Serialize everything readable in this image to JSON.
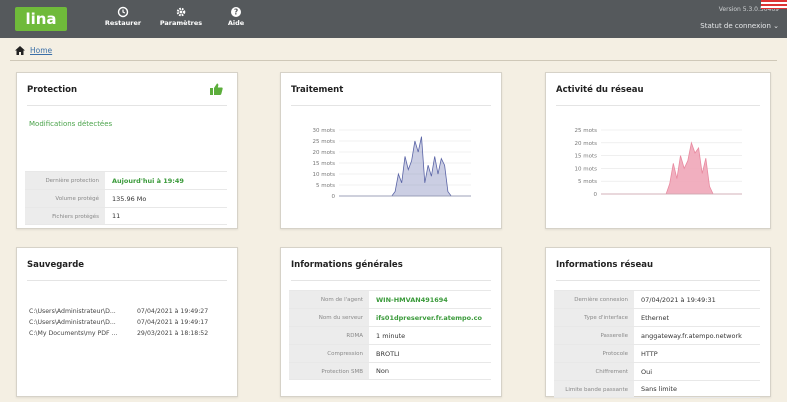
{
  "app": {
    "logo": "lina",
    "version": "Version 5.3.0.50469",
    "status_menu": "Statut de connexion"
  },
  "nav": [
    {
      "label": "Restaurer",
      "icon": "restore-icon"
    },
    {
      "label": "Paramètres",
      "icon": "gear-icon"
    },
    {
      "label": "Aide",
      "icon": "help-icon"
    }
  ],
  "breadcrumb": {
    "home": "Home"
  },
  "protection": {
    "title": "Protection",
    "message": "Modifications détectées",
    "rows": [
      {
        "key": "Dernière protection",
        "value": "Aujourd'hui à 19:49"
      },
      {
        "key": "Volume protégé",
        "value": "135.96 Mo"
      },
      {
        "key": "Fichiers protégés",
        "value": "11"
      }
    ]
  },
  "traitement": {
    "title": "Traitement",
    "color": "#6a74b0",
    "chart_data": {
      "type": "area",
      "title": "Traitement",
      "y_ticks": [
        "30 mots",
        "25 mots",
        "20 mots",
        "15 mots",
        "10 mots",
        "5 mots",
        "0"
      ],
      "ylim": [
        0,
        30
      ],
      "values": [
        0,
        0,
        0,
        0,
        0,
        0,
        0,
        0,
        0,
        0,
        0,
        0,
        0,
        0,
        0,
        0,
        0,
        2,
        10,
        6,
        18,
        12,
        16,
        25,
        20,
        27,
        6,
        14,
        9,
        18,
        10,
        17,
        14,
        2,
        0,
        0,
        0,
        0,
        0,
        0,
        0
      ]
    }
  },
  "reseau": {
    "title": "Activité du réseau",
    "color": "#f0a6b8",
    "chart_data": {
      "type": "area",
      "title": "Activité du réseau",
      "y_ticks": [
        "25 mots",
        "20 mots",
        "15 mots",
        "10 mots",
        "5 mots",
        "0"
      ],
      "ylim": [
        0,
        25
      ],
      "values": [
        0,
        0,
        0,
        0,
        0,
        0,
        0,
        0,
        0,
        0,
        0,
        0,
        0,
        0,
        0,
        0,
        0,
        0,
        0,
        4,
        12,
        6,
        15,
        10,
        13,
        20,
        16,
        18,
        8,
        14,
        3,
        0,
        0,
        0,
        0,
        0,
        0,
        0,
        0,
        0
      ]
    }
  },
  "sauvegarde": {
    "title": "Sauvegarde",
    "files": [
      {
        "path": "C:\\Users\\Administrateur\\D...",
        "date": "07/04/2021 à 19:49:27"
      },
      {
        "path": "C:\\Users\\Administrateur\\D...",
        "date": "07/04/2021 à 19:49:17"
      },
      {
        "path": "C:\\My Documents\\my PDF ...",
        "date": "29/03/2021 à 18:18:52"
      }
    ]
  },
  "infos_generales": {
    "title": "Informations générales",
    "rows": [
      {
        "key": "Nom de l'agent",
        "value": "WIN-HMVAN491694",
        "green": true
      },
      {
        "key": "Nom du serveur",
        "value": "ifs01dpreserver.fr.atempo.co",
        "green": true
      },
      {
        "key": "RDMA",
        "value": "1 minute",
        "green": false
      },
      {
        "key": "Compression",
        "value": "BROTLI",
        "green": false
      },
      {
        "key": "Protection SMB",
        "value": "Non",
        "green": false
      }
    ]
  },
  "infos_reseau": {
    "title": "Informations réseau",
    "rows": [
      {
        "key": "Dernière connexion",
        "value": "07/04/2021 à 19:49:31"
      },
      {
        "key": "Type d'interface",
        "value": "Ethernet"
      },
      {
        "key": "Passerelle",
        "value": "anggateway.fr.atempo.network"
      },
      {
        "key": "Protocole",
        "value": "HTTP"
      },
      {
        "key": "Chiffrement",
        "value": "Oui"
      },
      {
        "key": "Limite bande passante",
        "value": "Sans limite"
      }
    ]
  }
}
